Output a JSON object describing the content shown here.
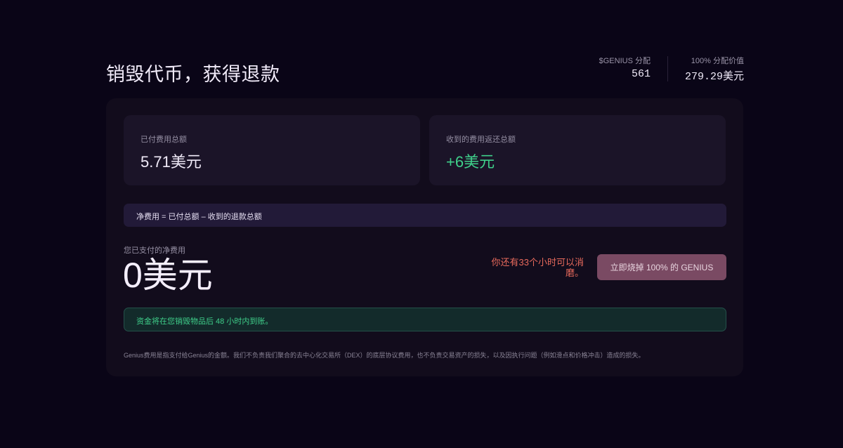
{
  "header": {
    "title": "销毁代币，获得退款",
    "stats": [
      {
        "label": "$GENIUS 分配",
        "value": "561"
      },
      {
        "label": "100% 分配价值",
        "value": "279.29美元"
      }
    ]
  },
  "fees": {
    "paid": {
      "label": "已付费用总额",
      "value": "5.71美元"
    },
    "refund": {
      "label": "收到的费用返还总额",
      "value": "+6美元"
    }
  },
  "formula": "净费用 = 已付总额 – 收到的退款总额",
  "net": {
    "label": "您已支付的净费用",
    "value": "0美元"
  },
  "warning": "你还有33个小时可以消磨。",
  "burn_button": "立即烧掉 100% 的 GENIUS",
  "notice": "资金将在您销毁物品后 48 小时内到账。",
  "disclaimer": "Genius费用是指支付给Genius的金额。我们不负责我们聚合的去中心化交易所（DEX）的底层协议费用，也不负责交易资产的损失，以及因执行问题（例如滑点和价格冲击）造成的损失。",
  "colors": {
    "background": "#0a0517",
    "card": "#120c1c",
    "positive": "#3fcf8a",
    "warning": "#e86a5c",
    "button": "#7a4a63"
  }
}
